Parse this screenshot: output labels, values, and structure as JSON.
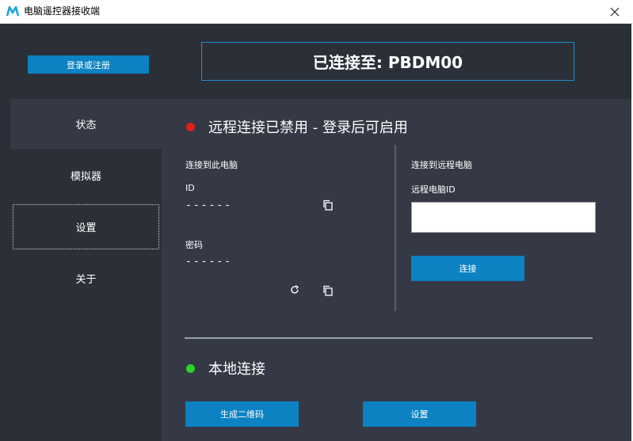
{
  "window": {
    "title": "电脑遥控器接收端"
  },
  "icons": {
    "app_logo": "app-logo-icon",
    "close": "close-icon",
    "copy": "copy-icon",
    "refresh": "refresh-icon"
  },
  "colors": {
    "accent": "#0c82c2",
    "status_disabled": "#e0201b",
    "status_ok": "#2ed12e",
    "background": "#2b2f38",
    "panel": "#353945"
  },
  "header": {
    "login_button": "登录或注册",
    "connection_status": "已连接至: PBDM00"
  },
  "sidebar": {
    "items": [
      {
        "label": "状态"
      },
      {
        "label": "模拟器"
      },
      {
        "label": "设置"
      },
      {
        "label": "关于"
      }
    ]
  },
  "remote": {
    "heading": "远程连接已禁用 - 登录后可启用",
    "this_pc": {
      "section_label": "连接到此电脑",
      "id_label": "ID",
      "id_value": "------",
      "password_label": "密码",
      "password_value": "------"
    },
    "remote_pc": {
      "section_label": "连接到远程电脑",
      "id_label": "远程电脑ID",
      "id_value": "",
      "connect_button": "连接"
    }
  },
  "local": {
    "heading": "本地连接",
    "qr_button": "生成二维码",
    "settings_button": "设置"
  }
}
